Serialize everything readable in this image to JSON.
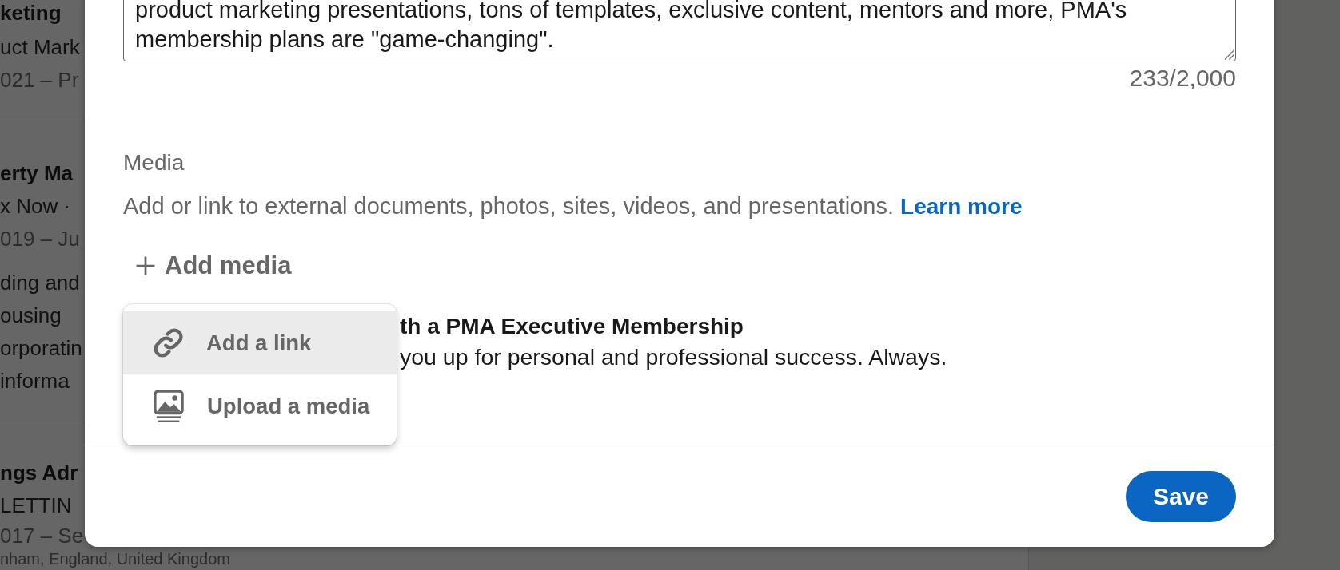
{
  "background": {
    "entries": [
      {
        "title": "keting",
        "company": "uct Mark",
        "dates": "021 – Pr"
      },
      {
        "title": "erty Ma",
        "company": "x Now ·",
        "dates": "019 – Ju",
        "description_lines": [
          "ding and",
          "ousing",
          "orporatin",
          "informa"
        ]
      },
      {
        "title": "ngs Adr",
        "company": "LETTIN",
        "dates": "017 – Se",
        "location": "nham, England, United Kingdom"
      }
    ]
  },
  "modal": {
    "description_field": {
      "value": "product marketing presentations, tons of templates, exclusive content, mentors and more, PMA's membership plans are \"game-changing\"."
    },
    "character_count": "233/2,000",
    "media": {
      "label": "Media",
      "help_text": "Add or link to external documents, photos, sites, videos, and presentations.",
      "help_link": "Learn more",
      "add_button": "Add media",
      "items": [
        {
          "title": "th a PMA Executive Membership",
          "description": "you up for personal and professional success. Always."
        }
      ]
    },
    "add_media_menu": {
      "items": [
        {
          "kind": "link",
          "label": "Add a link",
          "selected": true
        },
        {
          "kind": "upload",
          "label": "Upload a media",
          "selected": false
        }
      ]
    },
    "save_button": "Save"
  }
}
